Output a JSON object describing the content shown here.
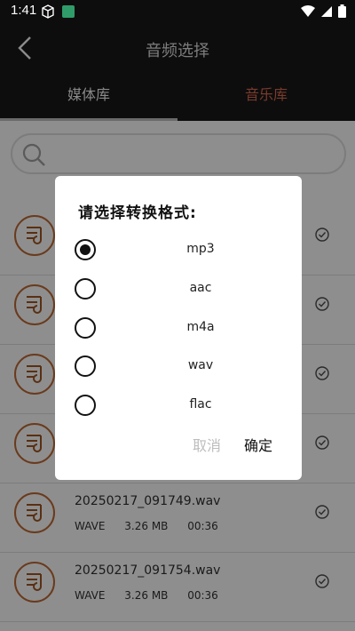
{
  "status": {
    "time": "1:41"
  },
  "header": {
    "title": "音频选择"
  },
  "tabs": [
    {
      "label": "媒体库",
      "active": true
    },
    {
      "label": "音乐库",
      "active": false
    }
  ],
  "files": [
    {
      "name": "",
      "format": "",
      "size": "",
      "duration": ""
    },
    {
      "name": "",
      "format": "",
      "size": "",
      "duration": ""
    },
    {
      "name": "",
      "format": "",
      "size": "",
      "duration": ""
    },
    {
      "name": "",
      "format": "",
      "size": "",
      "duration": ""
    },
    {
      "name": "20250217_091749.wav",
      "format": "WAVE",
      "size": "3.26 MB",
      "duration": "00:36"
    },
    {
      "name": "20250217_091754.wav",
      "format": "WAVE",
      "size": "3.26 MB",
      "duration": "00:36"
    }
  ],
  "dialog": {
    "title": "请选择转换格式:",
    "options": [
      {
        "label": "mp3",
        "selected": true
      },
      {
        "label": "aac",
        "selected": false
      },
      {
        "label": "m4a",
        "selected": false
      },
      {
        "label": "wav",
        "selected": false
      },
      {
        "label": "flac",
        "selected": false
      }
    ],
    "cancel_label": "取消",
    "ok_label": "确定"
  },
  "colors": {
    "accent_orange": "#c96a1e",
    "music_tab_text": "#7a3b2c"
  }
}
